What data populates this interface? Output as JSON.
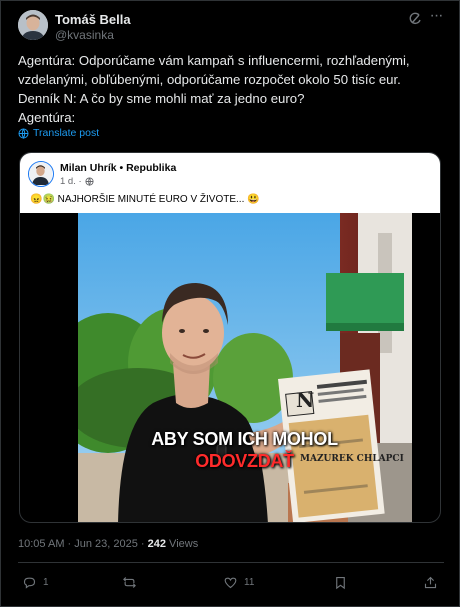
{
  "tweet": {
    "display_name": "Tomáš Bella",
    "handle": "@kvasinka",
    "lines": [
      "Agentúra: Odporúčame vám kampaň s influencermi, rozhľadenými,",
      "vzdelanými, obľúbenými, odporúčame rozpočet okolo 50 tisíc eur.",
      "Denník N: A čo by sme mohli mať za jedno euro?",
      "Agentúra:"
    ],
    "translate_label": "Translate post"
  },
  "card": {
    "author": "Milan Uhrík • Republika",
    "time": "1 d. ·",
    "text": "😠🤢 NAJHORŠIE MINUTÉ EURO V ŽIVOTE... 😃",
    "newspaper_headline": "MAZUREK CHLAPCI",
    "newspaper_logo": "N",
    "caption_line1": "ABY SOM ICH MOHOL",
    "caption_line2": "ODOVZDAŤ"
  },
  "meta": {
    "time": "10:05 AM · Jun 23, 2025 · ",
    "views_count": "242",
    "views_label": " Views"
  },
  "actions": {
    "reply_count": "1",
    "repost_count": "",
    "like_count": "11"
  },
  "colors": {
    "background": "#000000",
    "text": "#e7e9ea",
    "muted": "#71767b",
    "link": "#1d9bf0",
    "caption_red": "#ff2b2b"
  },
  "icons": [
    "grok-icon",
    "more-icon",
    "translate-icon",
    "globe-icon",
    "reply-icon",
    "repost-icon",
    "like-icon",
    "share-icon"
  ]
}
